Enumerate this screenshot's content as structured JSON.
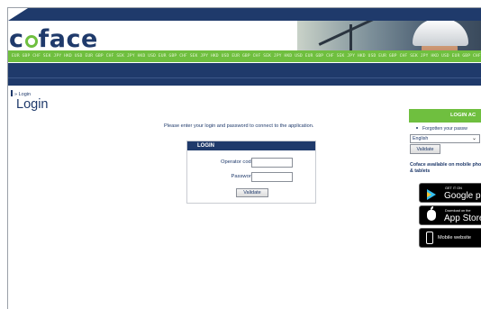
{
  "header": {
    "logo_text": "coface",
    "currency_ticker": "EUR GBP CHF SEK JPY HKD USD EUR GBP CHF SEK JPY HKD USD EUR GBP CHF SEK JPY HKD USD EUR GBP CHF SEK JPY HKD USD EUR GBP CHF SEK JPY HKD USD EUR GBP CHF SEK JPY HKD USD EUR GBP CHF SEK JPY HKD USD EUR GBP CHF SEK JPY HKD USD"
  },
  "breadcrumb": {
    "text": "» Login"
  },
  "page": {
    "title": "Login"
  },
  "login": {
    "instruction": "Please enter your login and password to connect to the application.",
    "header": "LOGIN",
    "operator_code_label": "Operator code",
    "operator_code_value": "",
    "password_label": "Password",
    "password_value": "",
    "validate_label": "Validate"
  },
  "side": {
    "header": "LOGIN AC",
    "forgot_link": "Forgotten your passw",
    "language_selected": "English",
    "validate_label": "Validate",
    "mobile_text": "Coface available on mobile phones & tablets",
    "google_small": "GET IT ON",
    "google_big": "Google pla",
    "apple_small": "Download on the",
    "apple_big": "App Store",
    "mobile_website": "Mobile website"
  },
  "colors": {
    "navy": "#1f3a6b",
    "green": "#6fbf3f"
  }
}
